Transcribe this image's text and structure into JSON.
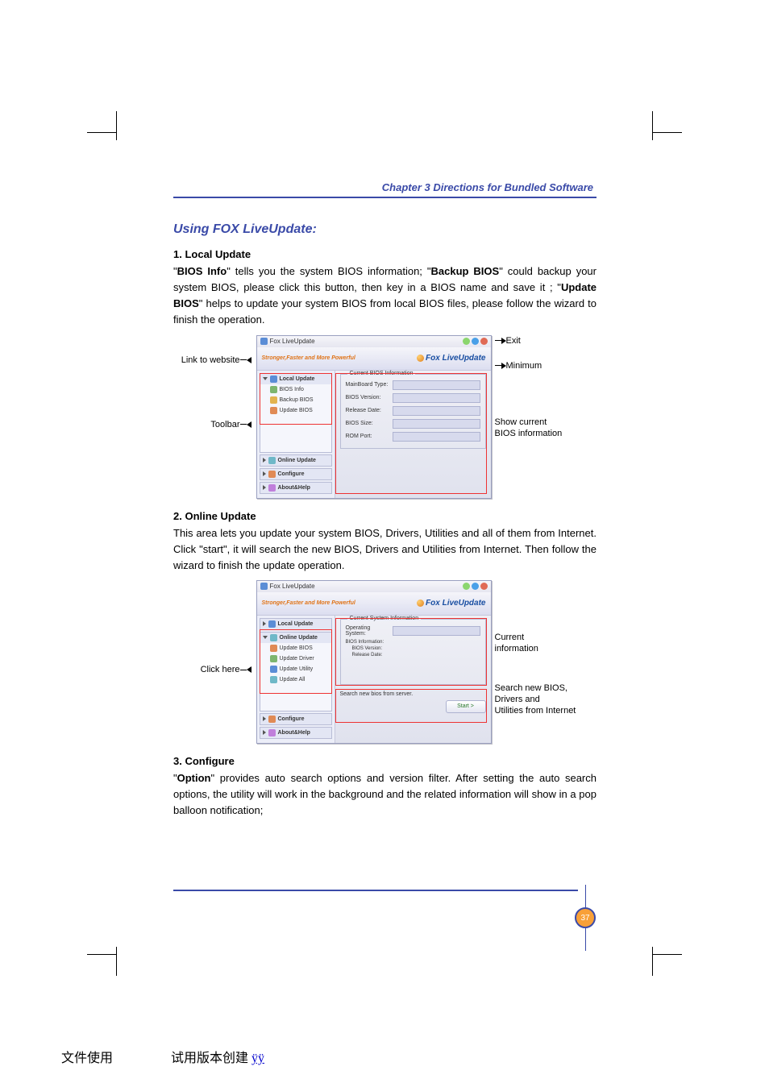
{
  "chapter_header": "Chapter 3    Directions for Bundled Software",
  "section_title": "Using FOX LiveUpdate:",
  "local_update": {
    "heading": "1. Local Update",
    "p_prefix": "\"",
    "p1": "BIOS Info",
    "p2": "\" tells you the system BIOS information; \"",
    "p3": "Backup BIOS",
    "p4": "\" could backup your system BIOS, please click this button, then key in a BIOS name and save it ; \"",
    "p5": "Update BIOS",
    "p6": "\" helps to update your system BIOS from local BIOS files, please  follow the wizard to finish the operation."
  },
  "fig1": {
    "window_title": "Fox LiveUpdate",
    "slogan": "Stronger,Faster and More Powerful",
    "brand": "Fox LiveUpdate",
    "side_heads": {
      "local": "Local Update",
      "online": "Online Update",
      "configure": "Configure",
      "about": "About&Help"
    },
    "side_items": {
      "bios_info": "BIOS Info",
      "backup_bios": "Backup BIOS",
      "update_bios": "Update BIOS"
    },
    "panel_title": "Current BIOS Information",
    "labels": {
      "mb": "MainBoard Type:",
      "ver": "BIOS Version:",
      "date": "Release Date:",
      "size": "BIOS Size:",
      "rom": "ROM Port:"
    },
    "anno": {
      "link": "Link to website",
      "toolbar": "Toolbar",
      "exit": "Exit",
      "min": "Minimum",
      "show1": "Show current",
      "show2": "BIOS information"
    }
  },
  "online_update": {
    "heading": "2. Online Update",
    "body": "This area lets you update your system BIOS, Drivers, Utilities and all of them from Internet. Click \"start\", it will search the new BIOS, Drivers and Utilities from Internet. Then follow the wizard to finish the update operation."
  },
  "fig2": {
    "window_title": "Fox LiveUpdate",
    "slogan": "Stronger,Faster and More Powerful",
    "brand": "Fox LiveUpdate",
    "side_heads": {
      "local": "Local Update",
      "online": "Online Update",
      "configure": "Configure",
      "about": "About&Help"
    },
    "side_items": {
      "update_bios": "Update BIOS",
      "update_driver": "Update Driver",
      "update_utility": "Update Utility",
      "update_all": "Update All"
    },
    "panel_title": "Current System Information",
    "labels": {
      "os": "Operating System:",
      "bios_info": "BIOS Information:",
      "bios_ver": "BIOS Version:",
      "rel_date": "Release Date:"
    },
    "search_text": "Search new bios from server.",
    "start_btn": "Start  >",
    "anno": {
      "click": "Click here",
      "cur1": "Current",
      "cur2": "information",
      "s1": "Search new BIOS,",
      "s2": "Drivers and",
      "s3": "Utilities from Internet"
    }
  },
  "configure": {
    "heading": "3. Configure",
    "p_prefix": "\"",
    "p1": "Option",
    "p2": "\" provides auto search options and version filter. After setting the auto search options, the utility will work in the background and the related information will show in a pop balloon notification;"
  },
  "page_number": "37",
  "footer": {
    "left": "文件使用 ",
    "mid": "试用版本创建 ",
    "link": "ÿÿ"
  }
}
